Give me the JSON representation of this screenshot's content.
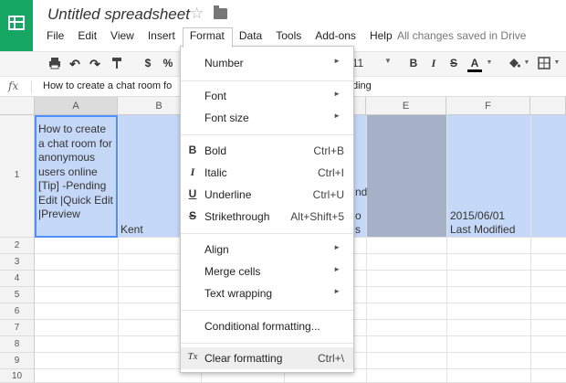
{
  "app": {
    "title": "Untitled spreadsheet",
    "save_status": "All changes saved in Drive"
  },
  "menu": [
    "File",
    "Edit",
    "View",
    "Insert",
    "Format",
    "Data",
    "Tools",
    "Add-ons",
    "Help"
  ],
  "toolbar": {
    "currency": "$",
    "percent": "%",
    "font_size": "11",
    "bold": "B",
    "italic": "I",
    "strike": "S",
    "text_color": "A"
  },
  "formula": {
    "fx": "fx",
    "value": "How to create a chat room fo",
    "tail": "ding"
  },
  "columns": [
    "A",
    "B",
    "C",
    "D",
    "E",
    "F"
  ],
  "rows": [
    "1",
    "2",
    "3",
    "4",
    "5",
    "6",
    "7",
    "8",
    "9",
    "10"
  ],
  "cells": {
    "a1": "How to create a chat room for anonymous users online [Tip] -Pending Edit |Quick Edit |Preview",
    "b1": "Kent",
    "d1_a": "nd",
    "d1_b": "o",
    "d1_c": "s",
    "f1_a": "2015/06/01",
    "f1_b": "Last Modified"
  },
  "format_menu": [
    {
      "label": "Number",
      "submenu": true
    },
    {
      "label": "Font",
      "submenu": true
    },
    {
      "label": "Font size",
      "submenu": true
    },
    {
      "label": "Bold",
      "shortcut": "Ctrl+B",
      "icon": "B"
    },
    {
      "label": "Italic",
      "shortcut": "Ctrl+I",
      "icon": "I"
    },
    {
      "label": "Underline",
      "shortcut": "Ctrl+U",
      "icon": "U"
    },
    {
      "label": "Strikethrough",
      "shortcut": "Alt+Shift+5",
      "icon": "S"
    },
    {
      "label": "Align",
      "submenu": true
    },
    {
      "label": "Merge cells",
      "submenu": true
    },
    {
      "label": "Text wrapping",
      "submenu": true
    },
    {
      "label": "Conditional formatting..."
    },
    {
      "label": "Clear formatting",
      "shortcut": "Ctrl+\\",
      "icon": "Tx"
    }
  ],
  "colors": {
    "brand": "#16a765",
    "selection": "#4d90fe",
    "row_highlight": "#c6d8f7"
  }
}
